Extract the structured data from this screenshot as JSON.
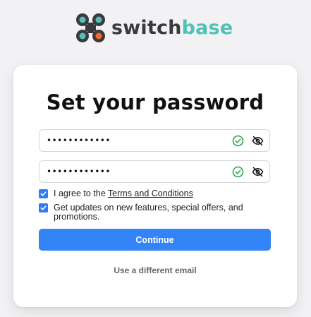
{
  "brand": {
    "name_part1": "switch",
    "name_part2": "base",
    "color_dark": "#3a3a3c",
    "color_accent": "#4ec2b6",
    "icon": "switchbase-logo-icon"
  },
  "form": {
    "title": "Set your password",
    "password": {
      "value": "••••••••••••",
      "valid": true,
      "valid_icon": "check-circle-icon",
      "toggle_icon": "eye-off-icon"
    },
    "confirm_password": {
      "value": "••••••••••••",
      "valid": true,
      "valid_icon": "check-circle-icon",
      "toggle_icon": "eye-off-icon"
    },
    "terms": {
      "checked": true,
      "prefix": "I agree to the ",
      "link_text": "Terms and Conditions"
    },
    "updates": {
      "checked": true,
      "label": "Get updates on new features, special offers, and promotions."
    },
    "continue_label": "Continue",
    "alt_link": "Use a different email"
  },
  "colors": {
    "primary": "#3384f7",
    "success": "#22a64a",
    "checkbox": "#2f7cf6"
  }
}
